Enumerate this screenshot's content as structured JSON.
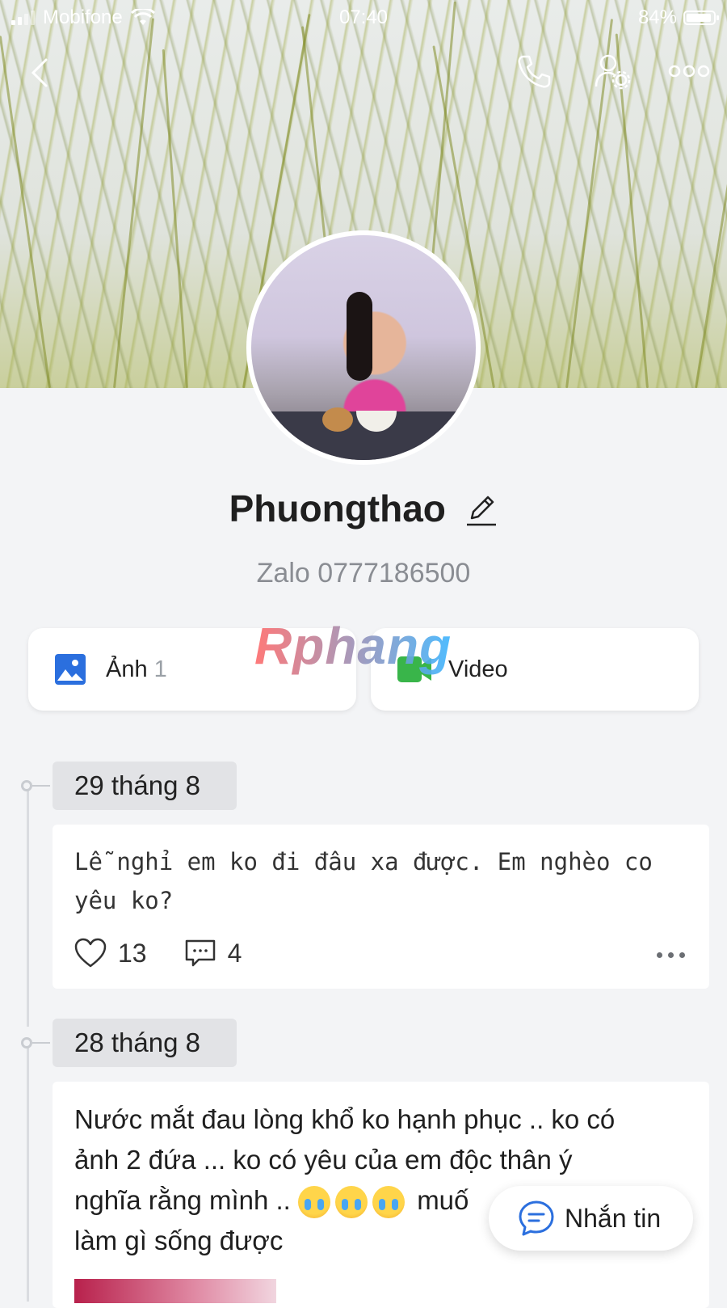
{
  "status_bar": {
    "carrier": "Mobifone",
    "time": "07:40",
    "battery_percent": "84%",
    "battery_level": 0.84
  },
  "nav": {
    "back_icon": "chevron-left-icon",
    "call_icon": "phone-icon",
    "profile_settings_icon": "user-settings-icon",
    "more_icon": "more-horizontal-icon"
  },
  "profile": {
    "name": "Phuongthao",
    "phone": "Zalo 0777186500"
  },
  "media": {
    "photos_label": "Ảnh",
    "photos_count": "1",
    "video_label": "Video"
  },
  "watermark": "Rphang",
  "posts": [
    {
      "date": "29 tháng 8",
      "text": "Lễ nghỉ em ko đi đâu xa được. Em nghèo co yêu ko?",
      "likes": "13",
      "comments": "4"
    },
    {
      "date": "28 tháng 8",
      "text_line1": "Nước mắt đau lòng khổ ko hạnh phục .. ko có",
      "text_line2": "ảnh 2 đứa ... ko có yêu của em độc thân ý",
      "text_line3_start": "nghĩa rằng mình ..",
      "text_line3_end": "muố",
      "text_line4": "làm gì sống được"
    }
  ],
  "message_button": {
    "label": "Nhắn tin"
  },
  "colors": {
    "accent_blue": "#2b6fde",
    "video_green": "#39b54a",
    "background": "#f3f4f6"
  }
}
